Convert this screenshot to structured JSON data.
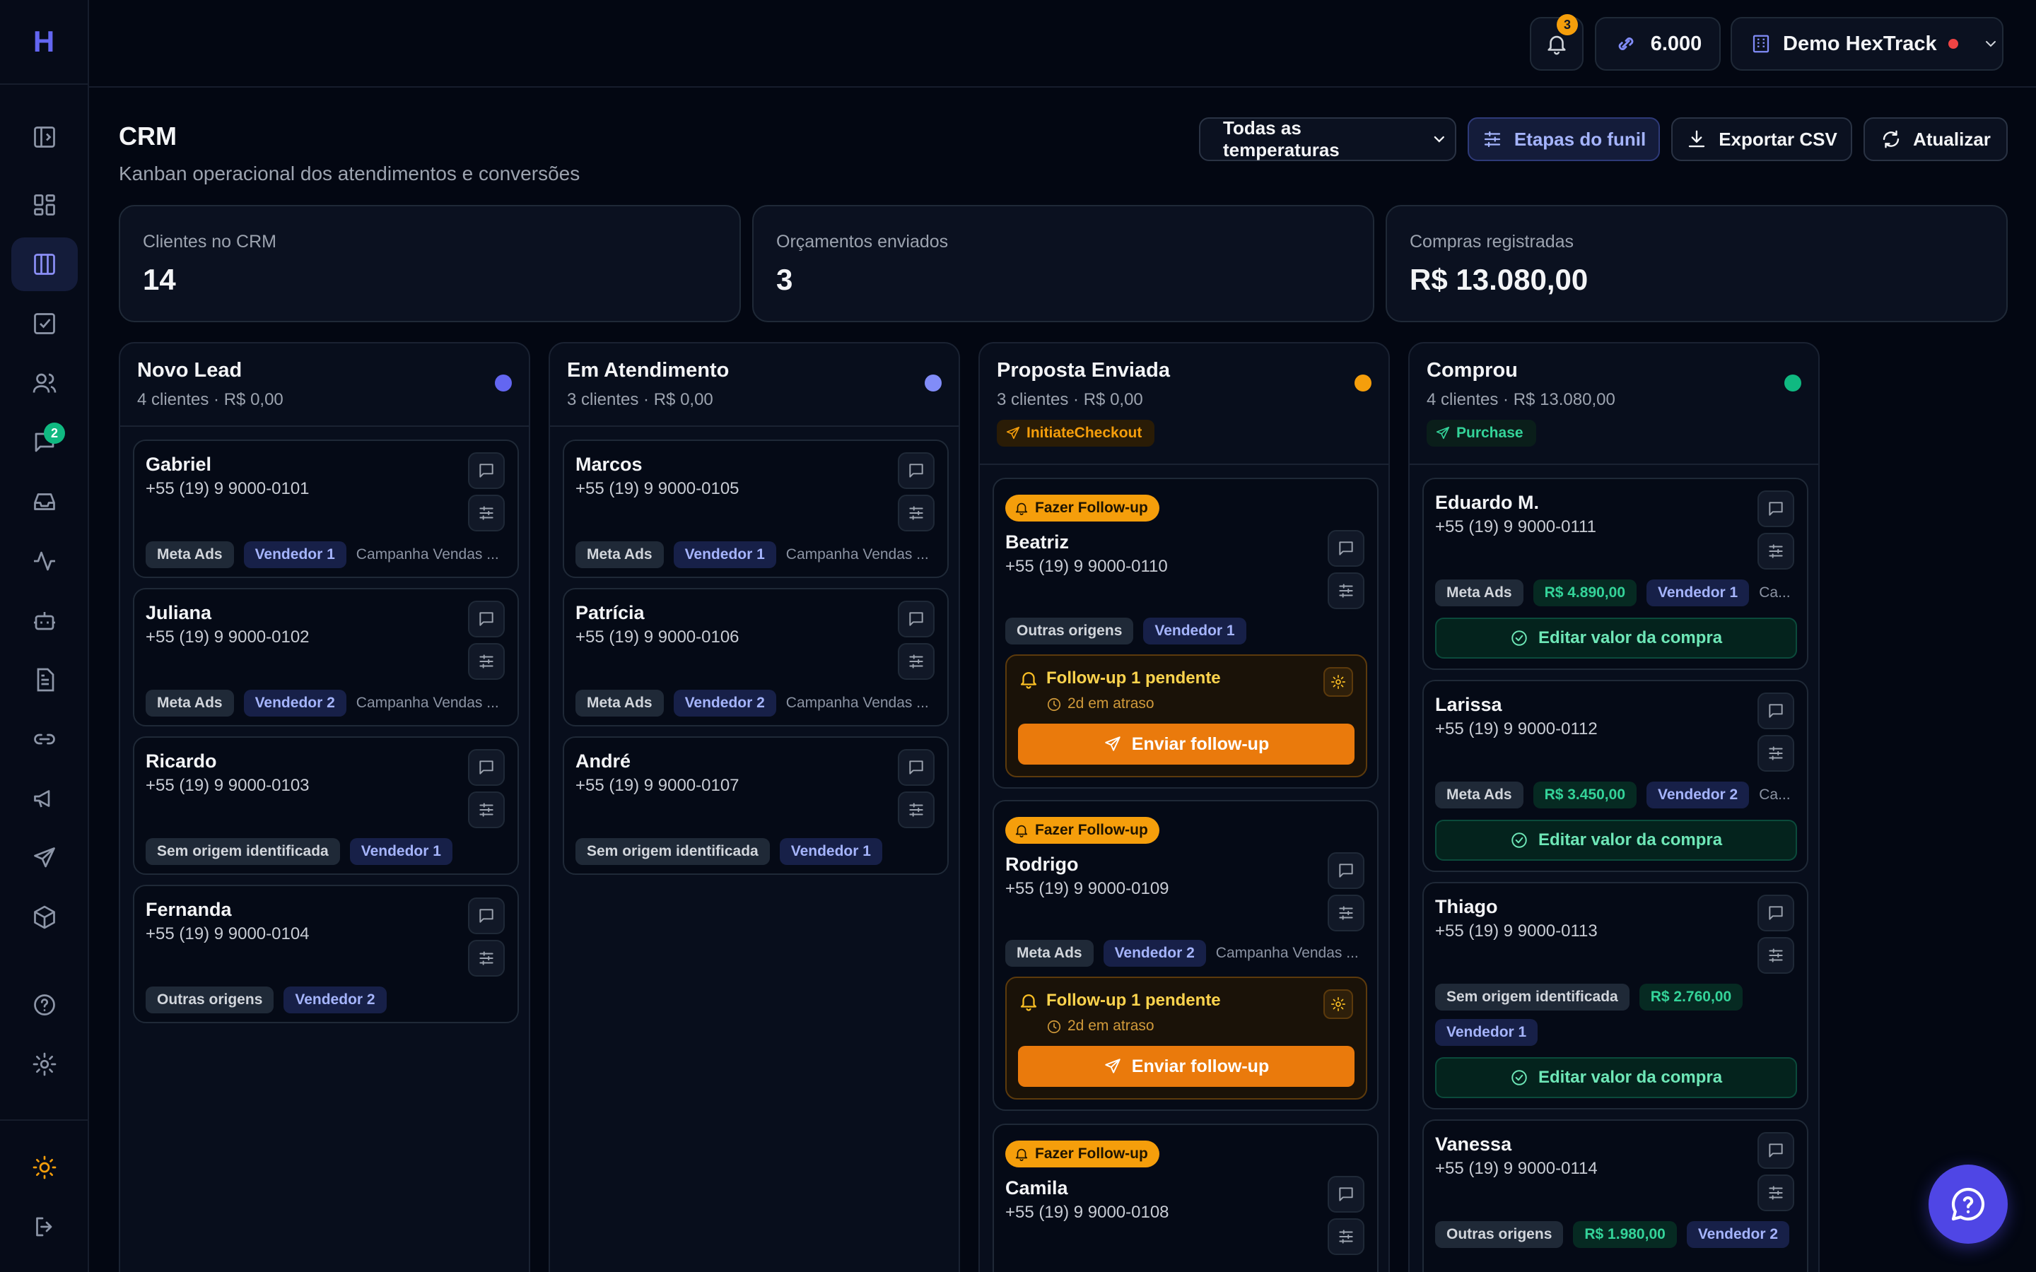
{
  "app": {
    "logo_letter": "H"
  },
  "topbar": {
    "notifications_count": "3",
    "credits": "6.000",
    "account_name": "Demo HexTrack"
  },
  "sidebar": {
    "chat_badge": "2"
  },
  "header": {
    "title": "CRM",
    "subtitle": "Kanban operacional dos atendimentos e conversões",
    "temperature_select": "Todas as temperaturas",
    "funnel_button": "Etapas do funil",
    "export_button": "Exportar CSV",
    "refresh_button": "Atualizar"
  },
  "stats": [
    {
      "label": "Clientes no CRM",
      "value": "14"
    },
    {
      "label": "Orçamentos enviados",
      "value": "3"
    },
    {
      "label": "Compras registradas",
      "value": "R$ 13.080,00"
    }
  ],
  "colors": {
    "accent": "#6366f1",
    "novo_lead_dot": "#6366f1",
    "em_atendimento_dot": "#818cf8",
    "proposta_dot": "#f59e0b",
    "comprou_dot": "#10b981"
  },
  "columns": {
    "novo": {
      "title": "Novo Lead",
      "summary": "4 clientes · R$ 0,00",
      "cards": [
        {
          "name": "Gabriel",
          "phone": "+55 (19) 9 9000-0101",
          "source": "Meta Ads",
          "seller": "Vendedor 1",
          "campaign": "Campanha Vendas ..."
        },
        {
          "name": "Juliana",
          "phone": "+55 (19) 9 9000-0102",
          "source": "Meta Ads",
          "seller": "Vendedor 2",
          "campaign": "Campanha Vendas ..."
        },
        {
          "name": "Ricardo",
          "phone": "+55 (19) 9 9000-0103",
          "source": "Sem origem identificada",
          "seller": "Vendedor 1"
        },
        {
          "name": "Fernanda",
          "phone": "+55 (19) 9 9000-0104",
          "source": "Outras origens",
          "seller": "Vendedor 2"
        }
      ]
    },
    "atendimento": {
      "title": "Em Atendimento",
      "summary": "3 clientes · R$ 0,00",
      "cards": [
        {
          "name": "Marcos",
          "phone": "+55 (19) 9 9000-0105",
          "source": "Meta Ads",
          "seller": "Vendedor 1",
          "campaign": "Campanha Vendas ..."
        },
        {
          "name": "Patrícia",
          "phone": "+55 (19) 9 9000-0106",
          "source": "Meta Ads",
          "seller": "Vendedor 2",
          "campaign": "Campanha Vendas ..."
        },
        {
          "name": "André",
          "phone": "+55 (19) 9 9000-0107",
          "source": "Sem origem identificada",
          "seller": "Vendedor 1"
        }
      ]
    },
    "proposta": {
      "title": "Proposta Enviada",
      "summary": "3 clientes · R$ 0,00",
      "event": "InitiateCheckout",
      "followup_badge": "Fazer Follow-up",
      "followup_title": "Follow-up 1 pendente",
      "followup_late": "2d em atraso",
      "followup_send": "Enviar follow-up",
      "cards": [
        {
          "name": "Beatriz",
          "phone": "+55 (19) 9 9000-0110",
          "source": "Outras origens",
          "seller": "Vendedor 1"
        },
        {
          "name": "Rodrigo",
          "phone": "+55 (19) 9 9000-0109",
          "source": "Meta Ads",
          "seller": "Vendedor 2",
          "campaign": "Campanha Vendas ..."
        },
        {
          "name": "Camila",
          "phone": "+55 (19) 9 9000-0108"
        }
      ]
    },
    "comprou": {
      "title": "Comprou",
      "summary": "4 clientes · R$ 13.080,00",
      "event": "Purchase",
      "edit_label": "Editar valor da compra",
      "cards": [
        {
          "name": "Eduardo M.",
          "phone": "+55 (19) 9 9000-0111",
          "source": "Meta Ads",
          "value": "R$ 4.890,00",
          "seller": "Vendedor 1",
          "campaign": "Ca..."
        },
        {
          "name": "Larissa",
          "phone": "+55 (19) 9 9000-0112",
          "source": "Meta Ads",
          "value": "R$ 3.450,00",
          "seller": "Vendedor 2",
          "campaign": "Ca..."
        },
        {
          "name": "Thiago",
          "phone": "+55 (19) 9 9000-0113",
          "source": "Sem origem identificada",
          "value": "R$ 2.760,00",
          "seller": "Vendedor 1"
        },
        {
          "name": "Vanessa",
          "phone": "+55 (19) 9 9000-0114",
          "source": "Outras origens",
          "value": "R$ 1.980,00",
          "seller": "Vendedor 2"
        }
      ]
    }
  }
}
